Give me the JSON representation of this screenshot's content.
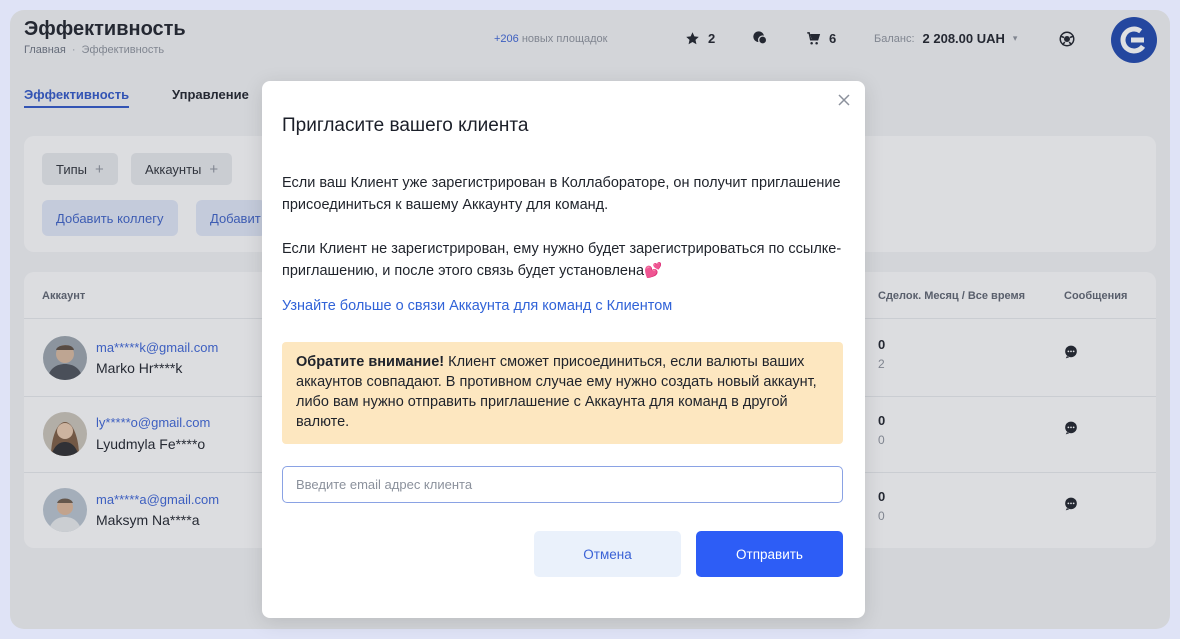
{
  "header": {
    "title": "Эффективность",
    "breadcrumb": [
      "Главная",
      "Эффективность"
    ],
    "new_sites_count": "+206",
    "new_sites_label": "новых площадок",
    "favorites_count": "2",
    "cart_count": "6",
    "balance_label": "Баланс:",
    "balance_value": "2 208.00 UAH"
  },
  "tabs": [
    "Эффективность",
    "Управление"
  ],
  "filters": {
    "types_label": "Типы",
    "accounts_label": "Аккаунты",
    "add_colleague_label": "Добавить коллегу",
    "add_second_label": "Добавит"
  },
  "table": {
    "col_account": "Аккаунт",
    "col_deals": "Сделок. Месяц / Все время",
    "col_messages": "Сообщения",
    "rows": [
      {
        "email": "ma*****k@gmail.com",
        "name": "Marko Hr****k",
        "deals_month": "0",
        "deals_all": "2"
      },
      {
        "email": "ly*****o@gmail.com",
        "name": "Lyudmyla Fe****o",
        "deals_month": "0",
        "deals_all": "0"
      },
      {
        "email": "ma*****a@gmail.com",
        "name": "Maksym Na****a",
        "deals_month": "0",
        "deals_all": "0"
      }
    ]
  },
  "modal": {
    "title": "Пригласите вашего клиента",
    "paragraph1": "Если ваш Клиент уже зарегистрирован в Коллабораторе, он получит приглашение присоединиться к вашему Аккаунту для команд.",
    "paragraph2": "Если Клиент не зарегистрирован, ему нужно будет зарегистрироваться по ссылке-приглашению, и после этого связь будет установлена💕",
    "link": "Узнайте больше о связи Аккаунта для команд с Клиентом",
    "notice_bold": "Обратите внимание!",
    "notice_text": " Клиент сможет присоединиться, если валюты ваших аккаунтов совпадают. В противном случае ему нужно создать новый аккаунт, либо вам нужно отправить приглашение с Аккаунта для команд в другой валюте.",
    "email_placeholder": "Введите email адрес клиента",
    "email_value": "",
    "cancel_label": "Отмена",
    "send_label": "Отправить"
  },
  "colors": {
    "accent": "#2d5df6",
    "link": "#3163d8",
    "notice_bg": "#fde7c0",
    "logo": "#1c45ae"
  }
}
